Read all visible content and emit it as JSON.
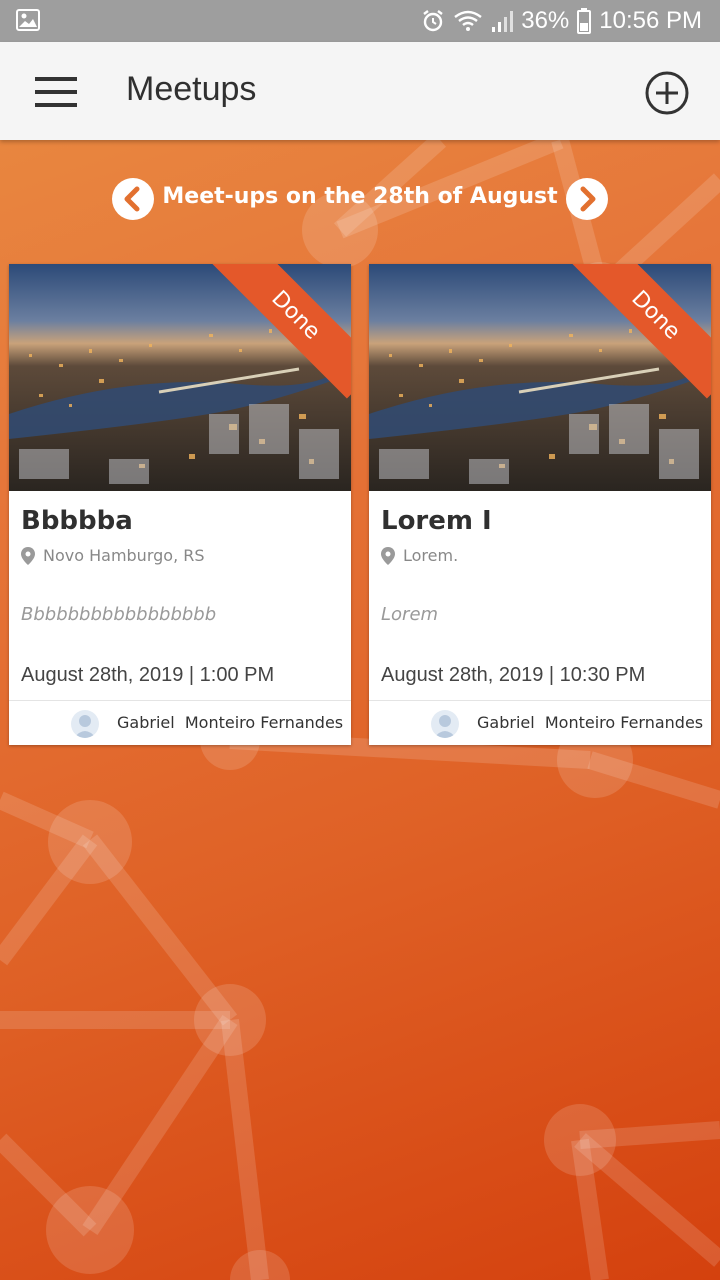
{
  "status_bar": {
    "battery": "36%",
    "time": "10:56 PM",
    "icons": [
      "image-icon",
      "alarm-icon",
      "wifi-icon",
      "signal-icon",
      "battery-icon"
    ]
  },
  "app_bar": {
    "title": "Meetups",
    "menu_icon": "hamburger-menu-icon",
    "add_icon": "add-circle-icon"
  },
  "date_nav": {
    "label": "Meet-ups on the 28th of August",
    "prev_icon": "chevron-left-circle-icon",
    "next_icon": "chevron-right-circle-icon"
  },
  "meetups": [
    {
      "badge": "Done",
      "title": "Bbbbba",
      "location": "Novo Hamburgo, RS",
      "description": "Bbbbbbbbbbbbbbbbb",
      "datetime": "August 28th, 2019  |  1:00 PM",
      "author": "Gabriel  Monteiro Fernandes"
    },
    {
      "badge": "Done",
      "title": "Lorem I",
      "location": "Lorem.",
      "description": "Lorem",
      "datetime": "August 28th, 2019  |  10:30 PM",
      "author": "Gabriel  Monteiro Fernandes"
    }
  ],
  "colors": {
    "accent": "#e4582a",
    "background_top": "#e8863f",
    "background_bottom": "#d4410e",
    "status_bar": "#9e9e9e",
    "app_bar": "#f5f5f5"
  }
}
